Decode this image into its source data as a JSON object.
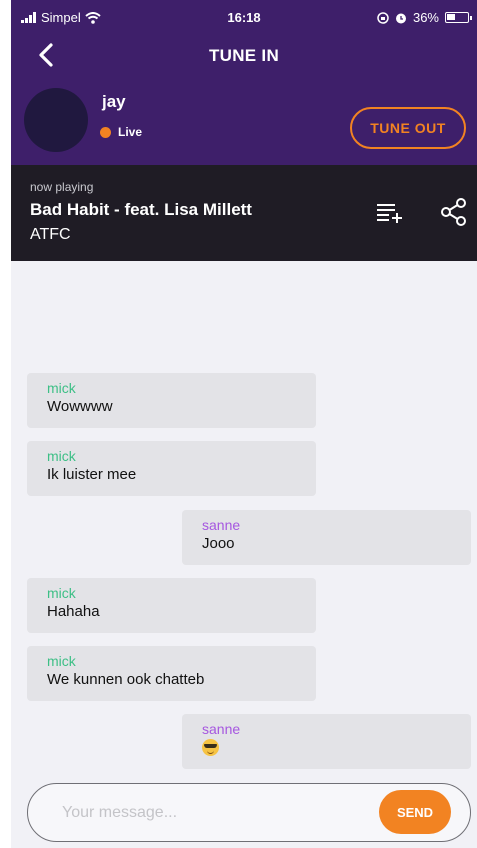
{
  "status_bar": {
    "carrier": "Simpel",
    "time": "16:18",
    "battery": "36%"
  },
  "nav": {
    "title": "TUNE IN"
  },
  "host": {
    "name": "jay",
    "status": "Live",
    "tune_out_label": "TUNE OUT"
  },
  "now_playing": {
    "label": "now playing",
    "title": "Bad Habit - feat. Lisa Millett",
    "artist": "ATFC"
  },
  "colors": {
    "header": "#3e1f6a",
    "accent": "#f28322",
    "mick": "#3dbf86",
    "sanne": "#a657e0"
  },
  "messages": [
    {
      "user": "mick",
      "text": "Wowwww"
    },
    {
      "user": "mick",
      "text": "Ik luister mee"
    },
    {
      "user": "sanne",
      "text": "Jooo"
    },
    {
      "user": "mick",
      "text": "Hahaha"
    },
    {
      "user": "mick",
      "text": "We kunnen ook chatteb"
    },
    {
      "user": "sanne",
      "text": "",
      "emoji": "smiling-face-with-sunglasses-icon"
    }
  ],
  "composer": {
    "placeholder": "Your message...",
    "send_label": "SEND"
  }
}
